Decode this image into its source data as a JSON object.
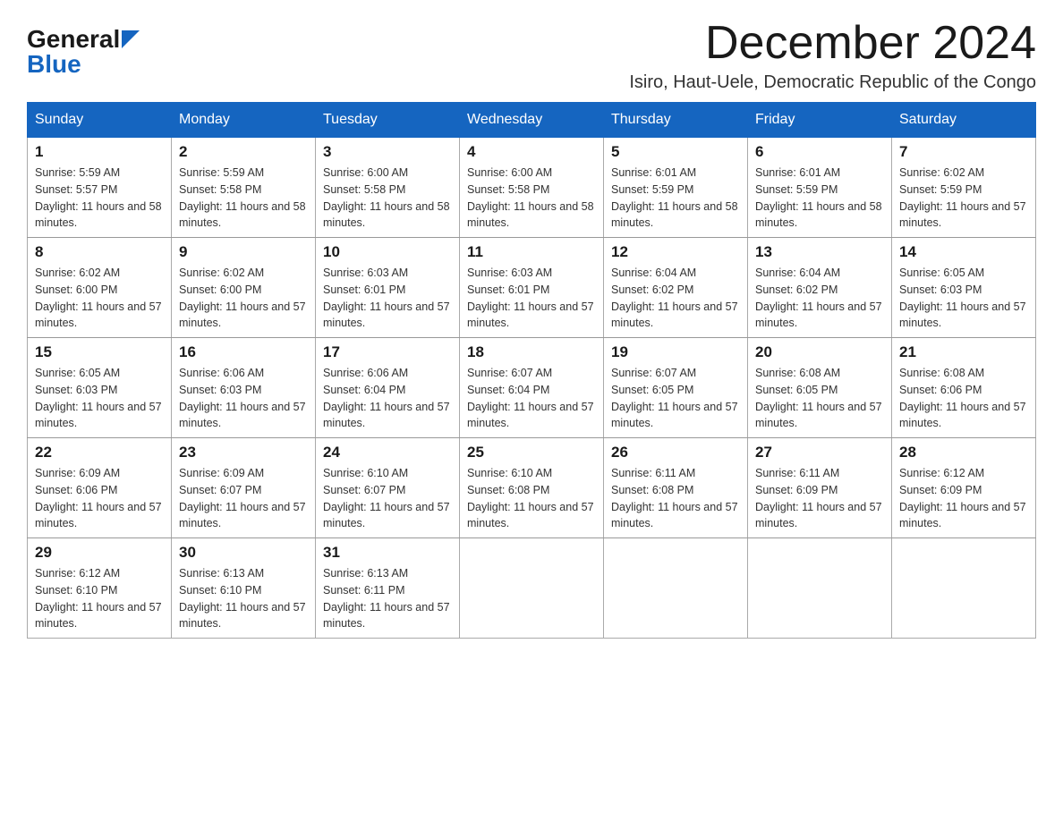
{
  "logo": {
    "general": "General",
    "blue": "Blue"
  },
  "title": "December 2024",
  "location": "Isiro, Haut-Uele, Democratic Republic of the Congo",
  "days_of_week": [
    "Sunday",
    "Monday",
    "Tuesday",
    "Wednesday",
    "Thursday",
    "Friday",
    "Saturday"
  ],
  "weeks": [
    [
      {
        "day": "1",
        "sunrise": "Sunrise: 5:59 AM",
        "sunset": "Sunset: 5:57 PM",
        "daylight": "Daylight: 11 hours and 58 minutes."
      },
      {
        "day": "2",
        "sunrise": "Sunrise: 5:59 AM",
        "sunset": "Sunset: 5:58 PM",
        "daylight": "Daylight: 11 hours and 58 minutes."
      },
      {
        "day": "3",
        "sunrise": "Sunrise: 6:00 AM",
        "sunset": "Sunset: 5:58 PM",
        "daylight": "Daylight: 11 hours and 58 minutes."
      },
      {
        "day": "4",
        "sunrise": "Sunrise: 6:00 AM",
        "sunset": "Sunset: 5:58 PM",
        "daylight": "Daylight: 11 hours and 58 minutes."
      },
      {
        "day": "5",
        "sunrise": "Sunrise: 6:01 AM",
        "sunset": "Sunset: 5:59 PM",
        "daylight": "Daylight: 11 hours and 58 minutes."
      },
      {
        "day": "6",
        "sunrise": "Sunrise: 6:01 AM",
        "sunset": "Sunset: 5:59 PM",
        "daylight": "Daylight: 11 hours and 58 minutes."
      },
      {
        "day": "7",
        "sunrise": "Sunrise: 6:02 AM",
        "sunset": "Sunset: 5:59 PM",
        "daylight": "Daylight: 11 hours and 57 minutes."
      }
    ],
    [
      {
        "day": "8",
        "sunrise": "Sunrise: 6:02 AM",
        "sunset": "Sunset: 6:00 PM",
        "daylight": "Daylight: 11 hours and 57 minutes."
      },
      {
        "day": "9",
        "sunrise": "Sunrise: 6:02 AM",
        "sunset": "Sunset: 6:00 PM",
        "daylight": "Daylight: 11 hours and 57 minutes."
      },
      {
        "day": "10",
        "sunrise": "Sunrise: 6:03 AM",
        "sunset": "Sunset: 6:01 PM",
        "daylight": "Daylight: 11 hours and 57 minutes."
      },
      {
        "day": "11",
        "sunrise": "Sunrise: 6:03 AM",
        "sunset": "Sunset: 6:01 PM",
        "daylight": "Daylight: 11 hours and 57 minutes."
      },
      {
        "day": "12",
        "sunrise": "Sunrise: 6:04 AM",
        "sunset": "Sunset: 6:02 PM",
        "daylight": "Daylight: 11 hours and 57 minutes."
      },
      {
        "day": "13",
        "sunrise": "Sunrise: 6:04 AM",
        "sunset": "Sunset: 6:02 PM",
        "daylight": "Daylight: 11 hours and 57 minutes."
      },
      {
        "day": "14",
        "sunrise": "Sunrise: 6:05 AM",
        "sunset": "Sunset: 6:03 PM",
        "daylight": "Daylight: 11 hours and 57 minutes."
      }
    ],
    [
      {
        "day": "15",
        "sunrise": "Sunrise: 6:05 AM",
        "sunset": "Sunset: 6:03 PM",
        "daylight": "Daylight: 11 hours and 57 minutes."
      },
      {
        "day": "16",
        "sunrise": "Sunrise: 6:06 AM",
        "sunset": "Sunset: 6:03 PM",
        "daylight": "Daylight: 11 hours and 57 minutes."
      },
      {
        "day": "17",
        "sunrise": "Sunrise: 6:06 AM",
        "sunset": "Sunset: 6:04 PM",
        "daylight": "Daylight: 11 hours and 57 minutes."
      },
      {
        "day": "18",
        "sunrise": "Sunrise: 6:07 AM",
        "sunset": "Sunset: 6:04 PM",
        "daylight": "Daylight: 11 hours and 57 minutes."
      },
      {
        "day": "19",
        "sunrise": "Sunrise: 6:07 AM",
        "sunset": "Sunset: 6:05 PM",
        "daylight": "Daylight: 11 hours and 57 minutes."
      },
      {
        "day": "20",
        "sunrise": "Sunrise: 6:08 AM",
        "sunset": "Sunset: 6:05 PM",
        "daylight": "Daylight: 11 hours and 57 minutes."
      },
      {
        "day": "21",
        "sunrise": "Sunrise: 6:08 AM",
        "sunset": "Sunset: 6:06 PM",
        "daylight": "Daylight: 11 hours and 57 minutes."
      }
    ],
    [
      {
        "day": "22",
        "sunrise": "Sunrise: 6:09 AM",
        "sunset": "Sunset: 6:06 PM",
        "daylight": "Daylight: 11 hours and 57 minutes."
      },
      {
        "day": "23",
        "sunrise": "Sunrise: 6:09 AM",
        "sunset": "Sunset: 6:07 PM",
        "daylight": "Daylight: 11 hours and 57 minutes."
      },
      {
        "day": "24",
        "sunrise": "Sunrise: 6:10 AM",
        "sunset": "Sunset: 6:07 PM",
        "daylight": "Daylight: 11 hours and 57 minutes."
      },
      {
        "day": "25",
        "sunrise": "Sunrise: 6:10 AM",
        "sunset": "Sunset: 6:08 PM",
        "daylight": "Daylight: 11 hours and 57 minutes."
      },
      {
        "day": "26",
        "sunrise": "Sunrise: 6:11 AM",
        "sunset": "Sunset: 6:08 PM",
        "daylight": "Daylight: 11 hours and 57 minutes."
      },
      {
        "day": "27",
        "sunrise": "Sunrise: 6:11 AM",
        "sunset": "Sunset: 6:09 PM",
        "daylight": "Daylight: 11 hours and 57 minutes."
      },
      {
        "day": "28",
        "sunrise": "Sunrise: 6:12 AM",
        "sunset": "Sunset: 6:09 PM",
        "daylight": "Daylight: 11 hours and 57 minutes."
      }
    ],
    [
      {
        "day": "29",
        "sunrise": "Sunrise: 6:12 AM",
        "sunset": "Sunset: 6:10 PM",
        "daylight": "Daylight: 11 hours and 57 minutes."
      },
      {
        "day": "30",
        "sunrise": "Sunrise: 6:13 AM",
        "sunset": "Sunset: 6:10 PM",
        "daylight": "Daylight: 11 hours and 57 minutes."
      },
      {
        "day": "31",
        "sunrise": "Sunrise: 6:13 AM",
        "sunset": "Sunset: 6:11 PM",
        "daylight": "Daylight: 11 hours and 57 minutes."
      },
      {
        "day": "",
        "sunrise": "",
        "sunset": "",
        "daylight": ""
      },
      {
        "day": "",
        "sunrise": "",
        "sunset": "",
        "daylight": ""
      },
      {
        "day": "",
        "sunrise": "",
        "sunset": "",
        "daylight": ""
      },
      {
        "day": "",
        "sunrise": "",
        "sunset": "",
        "daylight": ""
      }
    ]
  ]
}
